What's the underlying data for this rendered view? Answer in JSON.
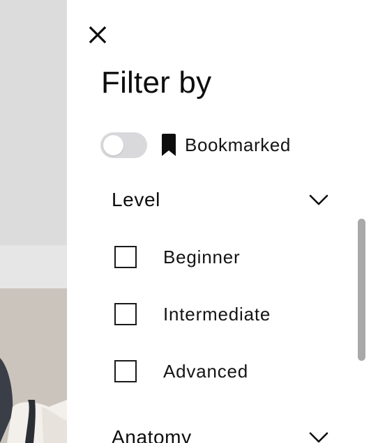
{
  "drawer": {
    "title": "Filter by",
    "close_icon": "close-icon",
    "bookmark": {
      "label": "Bookmarked",
      "icon": "bookmark-icon",
      "toggle_on": false
    },
    "sections": [
      {
        "title": "Level",
        "expanded": true,
        "options": [
          {
            "label": "Beginner",
            "checked": false
          },
          {
            "label": "Intermediate",
            "checked": false
          },
          {
            "label": "Advanced",
            "checked": false
          }
        ]
      },
      {
        "title": "Anatomy",
        "expanded": false
      }
    ]
  },
  "colors": {
    "text": "#0d0d0d",
    "toggle_off": "#d9d9dc",
    "scrollbar": "#a9a9a9",
    "backdrop": "#dcdcdc"
  }
}
